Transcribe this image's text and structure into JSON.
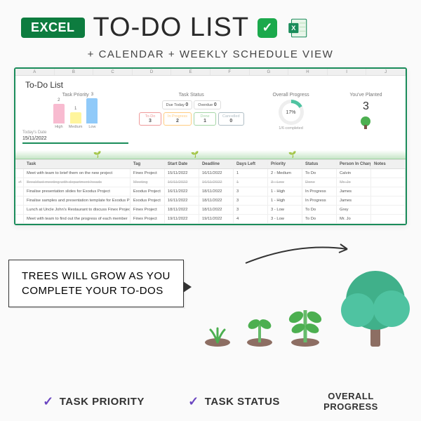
{
  "hero": {
    "badge": "EXCEL",
    "title": "TO-DO LIST",
    "subtitle": "+ CALENDAR + WEEKLY SCHEDULE VIEW"
  },
  "ss": {
    "title": "To-Do List",
    "cols": [
      "A",
      "B",
      "C",
      "D",
      "E",
      "F",
      "G",
      "H",
      "I",
      "J"
    ],
    "priority": {
      "title": "Task Priority",
      "bars": [
        {
          "label": "High",
          "val": "2",
          "h": 28,
          "color": "#f8bbd0"
        },
        {
          "label": "Medium",
          "val": "1",
          "h": 16,
          "color": "#fff59d"
        },
        {
          "label": "Low",
          "val": "3",
          "h": 36,
          "color": "#90caf9"
        }
      ]
    },
    "today": {
      "label": "Today's Date",
      "value": "15/11/2022"
    },
    "status": {
      "title": "Task Status",
      "top": [
        {
          "l": "Due Today",
          "n": "0"
        },
        {
          "l": "Overdue",
          "n": "0"
        }
      ],
      "bottom": [
        {
          "l": "To-Do",
          "n": "3",
          "c": "#ef9a9a"
        },
        {
          "l": "In Progress",
          "n": "2",
          "c": "#ffcc80"
        },
        {
          "l": "Done",
          "n": "1",
          "c": "#a5d6a7"
        },
        {
          "l": "Cancelled",
          "n": "0",
          "c": "#b0bec5"
        }
      ]
    },
    "progress": {
      "title": "Overall Progress",
      "pct": "17%",
      "sub": "1/6 completed"
    },
    "planted": {
      "title": "You've Planted",
      "n": "3"
    },
    "headers": [
      "",
      "Task",
      "Tag",
      "Start Date",
      "Deadline",
      "Days Left",
      "Priority",
      "Status",
      "Person In Charge",
      "Notes"
    ],
    "rows": [
      {
        "chk": "",
        "task": "Meet with team to brief them on the new project",
        "tag": "Finex Project",
        "sd": "15/11/2022",
        "dl": "16/11/2022",
        "days": "1",
        "pri": "2 - Medium",
        "stat": "To Do",
        "pic": "Calvin",
        "done": false
      },
      {
        "chk": "✔",
        "task": "Breakfast meeting with department heads",
        "tag": "Meeting",
        "sd": "16/11/2022",
        "dl": "16/11/2022",
        "days": "1",
        "pri": "3 - Low",
        "stat": "Done",
        "pic": "Mr. Jo",
        "done": true
      },
      {
        "chk": "",
        "task": "Finalise presentation slides for Exodus Project",
        "tag": "Exodus Project",
        "sd": "16/11/2022",
        "dl": "18/11/2022",
        "days": "3",
        "pri": "1 - High",
        "stat": "In Progress",
        "pic": "James",
        "done": false
      },
      {
        "chk": "",
        "task": "Finalise samples and presentation template for Exodus Project",
        "tag": "Exodus Project",
        "sd": "16/11/2022",
        "dl": "18/11/2022",
        "days": "3",
        "pri": "1 - High",
        "stat": "In Progress",
        "pic": "James",
        "done": false
      },
      {
        "chk": "",
        "task": "Lunch at Uncle John's Restaurant to discuss Finex Project",
        "tag": "Finex Project",
        "sd": "18/11/2022",
        "dl": "18/11/2022",
        "days": "3",
        "pri": "3 - Low",
        "stat": "To Do",
        "pic": "Grey",
        "done": false
      },
      {
        "chk": "",
        "task": "Meet with team to find out the progress of each member",
        "tag": "Finex Project",
        "sd": "19/11/2022",
        "dl": "19/11/2022",
        "days": "4",
        "pri": "3 - Low",
        "stat": "To Do",
        "pic": "Mr. Jo",
        "done": false
      }
    ]
  },
  "callout": {
    "l1": "TREES WILL GROW AS YOU",
    "l2": "COMPLETE YOUR TO-DOS"
  },
  "features": {
    "f1": "TASK PRIORITY",
    "f2": "TASK STATUS",
    "f3a": "OVERALL",
    "f3b": "PROGRESS"
  }
}
